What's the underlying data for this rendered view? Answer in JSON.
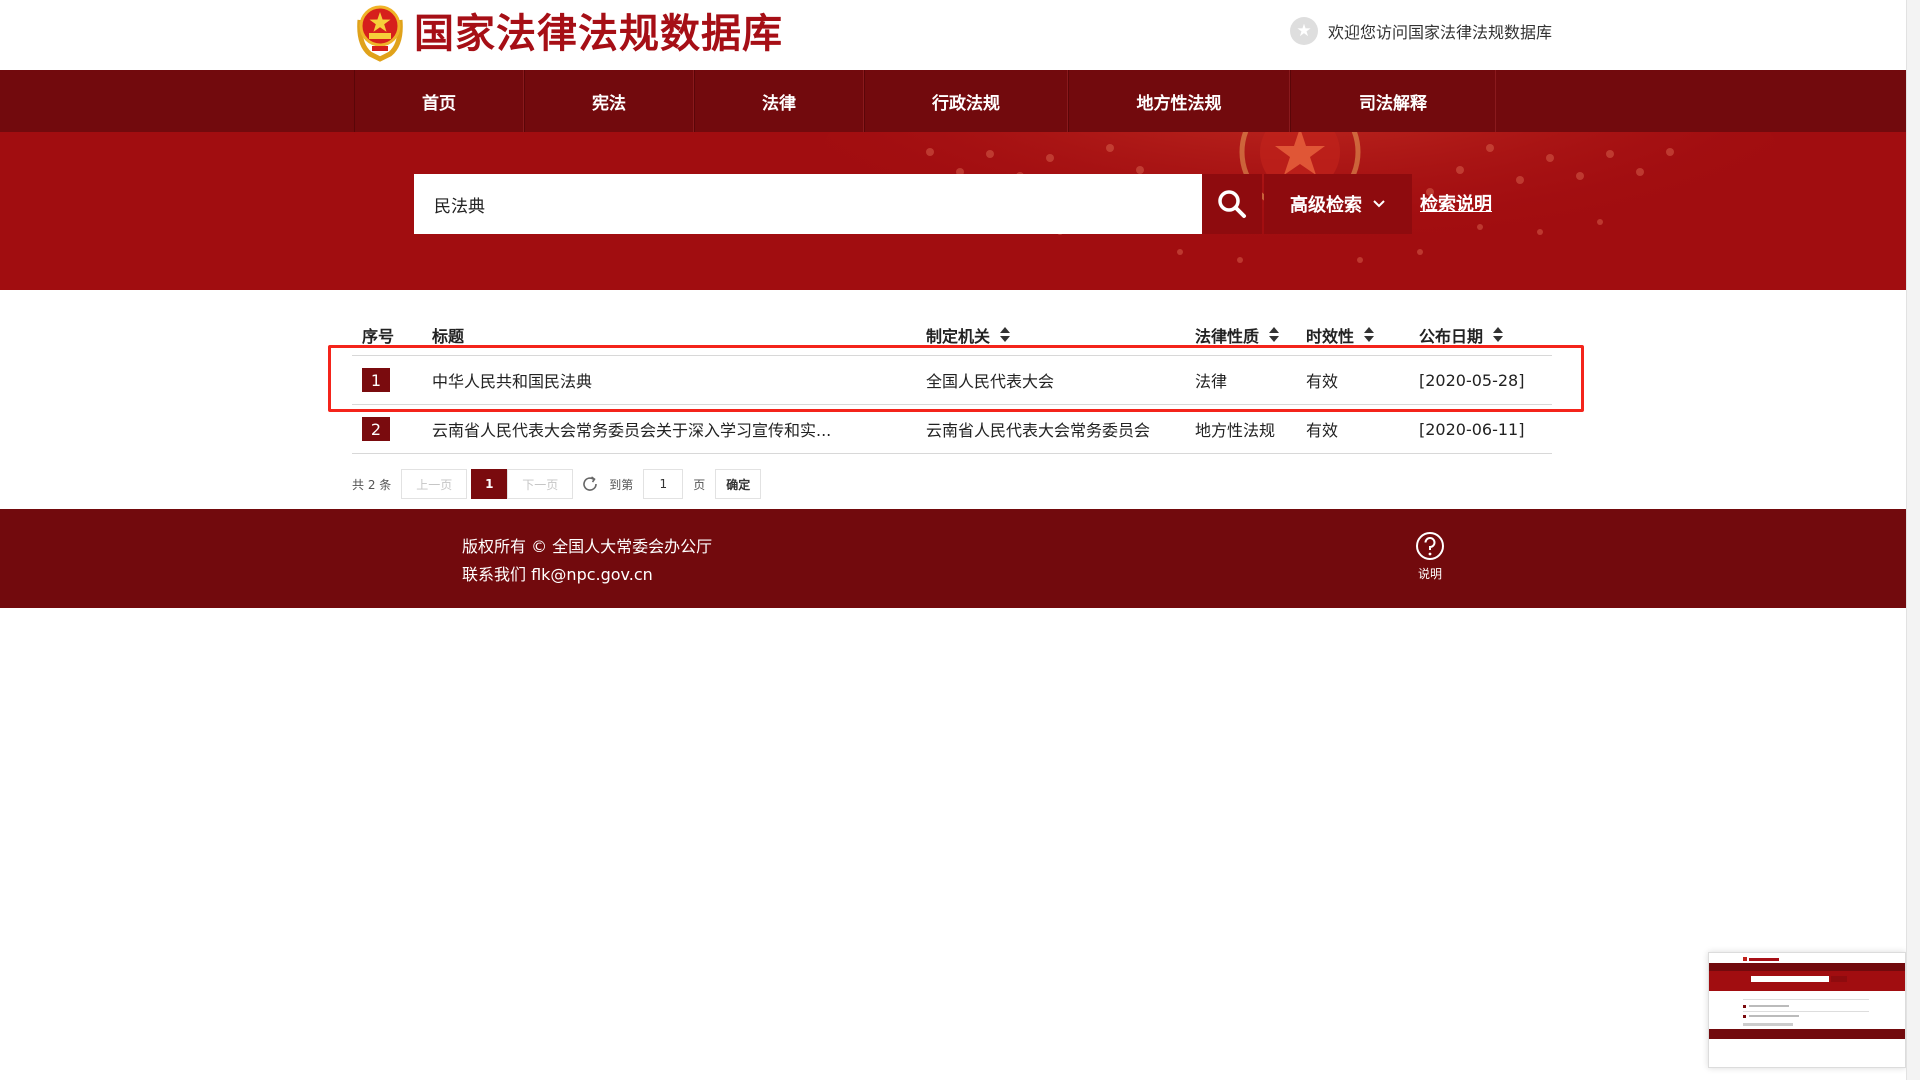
{
  "header": {
    "site_title": "国家法律法规数据库",
    "welcome_text": "欢迎您访问国家法律法规数据库",
    "star_icon": "star-icon"
  },
  "nav": {
    "items": [
      {
        "label": "首页"
      },
      {
        "label": "宪法"
      },
      {
        "label": "法律"
      },
      {
        "label": "行政法规"
      },
      {
        "label": "地方性法规"
      },
      {
        "label": "司法解释"
      }
    ]
  },
  "search": {
    "value": "民法典",
    "advanced_label": "高级检索",
    "help_label": "检索说明"
  },
  "table": {
    "headers": {
      "index": "序号",
      "title": "标题",
      "authority": "制定机关",
      "nature": "法律性质",
      "status": "时效性",
      "date": "公布日期"
    },
    "rows": [
      {
        "index": "1",
        "title": "中华人民共和国民法典",
        "authority": "全国人民代表大会",
        "nature": "法律",
        "status": "有效",
        "date": "[2020-05-28]"
      },
      {
        "index": "2",
        "title": "云南省人民代表大会常务委员会关于深入学习宣传和实...",
        "authority": "云南省人民代表大会常务委员会",
        "nature": "地方性法规",
        "status": "有效",
        "date": "[2020-06-11]"
      }
    ]
  },
  "pagination": {
    "total": "共 2 条",
    "prev": "上一页",
    "current": "1",
    "next": "下一页",
    "goto_prefix": "到第",
    "goto_value": "1",
    "goto_suffix": "页",
    "confirm": "确定"
  },
  "footer": {
    "copyright": "版权所有 © 全国人大常委会办公厅",
    "contact": "联系我们 flk@npc.gov.cn",
    "help_label": "说明"
  },
  "colors": {
    "brand_red": "#a60f16",
    "nav_dark": "#720a0d",
    "highlight": "#f4241b"
  }
}
